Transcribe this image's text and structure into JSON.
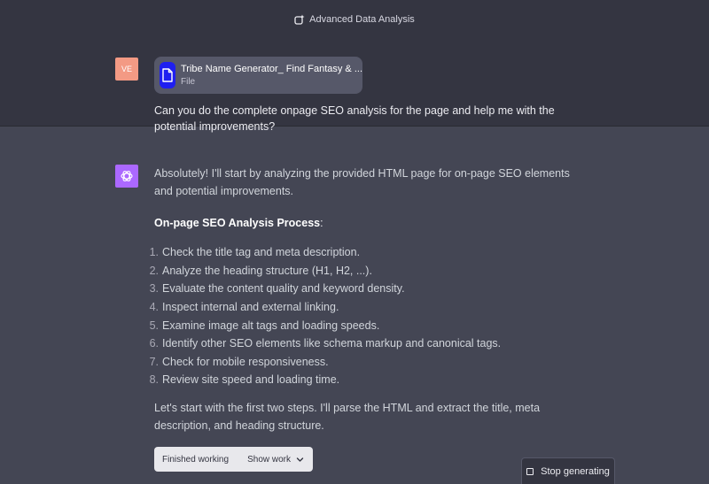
{
  "header": {
    "model_label": "Advanced Data Analysis",
    "model_icon": "sparkle-icon"
  },
  "user": {
    "avatar_initials": "VE",
    "avatar_color": "#f39a84",
    "file": {
      "name": "Tribe Name Generator_ Find Fantasy & ...",
      "type": "File",
      "icon": "document-icon",
      "icon_color": "#1f1ff0"
    },
    "message": "Can you do the complete onpage SEO analysis for the page and help me with the potential improvements?"
  },
  "assistant": {
    "avatar_icon": "openai-logo-icon",
    "avatar_color": "#ab68ff",
    "intro": "Absolutely! I'll start by analyzing the provided HTML page for on-page SEO elements and potential improvements.",
    "heading": "On-page SEO Analysis Process",
    "heading_suffix": ":",
    "steps": [
      "Check the title tag and meta description.",
      "Analyze the heading structure (H1, H2, ...).",
      "Evaluate the content quality and keyword density.",
      "Inspect internal and external linking.",
      "Examine image alt tags and loading speeds.",
      "Identify other SEO elements like schema markup and canonical tags.",
      "Check for mobile responsiveness.",
      "Review site speed and loading time."
    ],
    "closing": "Let's start with the first two steps. I'll parse the HTML and extract the title, meta description, and heading structure.",
    "work_status": {
      "label": "Finished working",
      "toggle_label": "Show work"
    }
  },
  "controls": {
    "stop_label": "Stop generating"
  },
  "colors": {
    "background_main": "#444654",
    "background_user": "#343541"
  }
}
